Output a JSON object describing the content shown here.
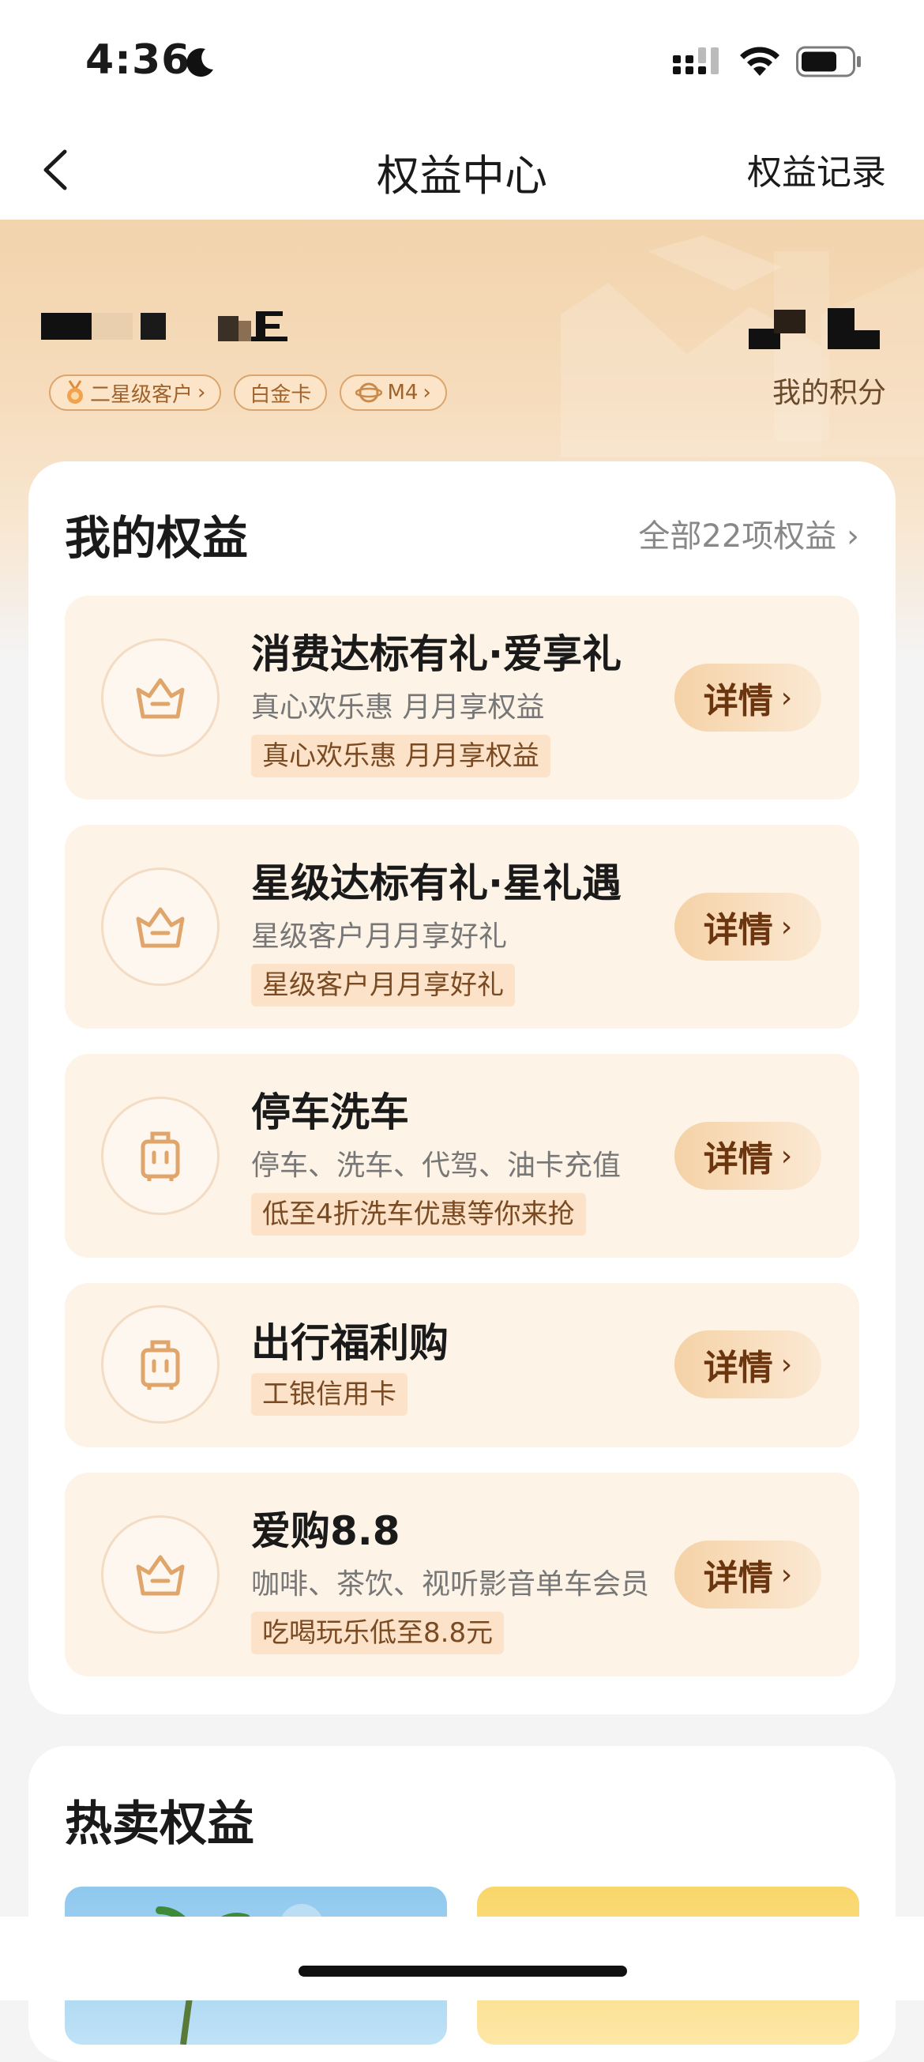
{
  "status_bar": {
    "time": "4:36"
  },
  "nav": {
    "title": "权益中心",
    "right_label": "权益记录"
  },
  "user": {
    "points_label": "我的积分",
    "badges": [
      {
        "label": "二星级客户",
        "icon": "medal-icon"
      },
      {
        "label": "白金卡"
      },
      {
        "label": "M4",
        "icon": "planet-icon"
      }
    ]
  },
  "my_rights": {
    "title": "我的权益",
    "more_label": "全部22项权益",
    "detail_label": "详情",
    "items": [
      {
        "title": "消费达标有礼·爱享礼",
        "subtitle": "真心欢乐惠 月月享权益",
        "tag": "真心欢乐惠 月月享权益",
        "icon": "basket-icon"
      },
      {
        "title": "星级达标有礼·星礼遇",
        "subtitle": "星级客户月月享好礼",
        "tag": "星级客户月月享好礼",
        "icon": "basket-icon"
      },
      {
        "title": "停车洗车",
        "subtitle": "停车、洗车、代驾、油卡充值",
        "tag": "低至4折洗车优惠等你来抢",
        "icon": "luggage-icon"
      },
      {
        "title": "出行福利购",
        "subtitle": "",
        "tag": "工银信用卡",
        "icon": "luggage-icon"
      },
      {
        "title": "爱购8.8",
        "subtitle": "咖啡、茶饮、视听影音单车会员",
        "tag": "吃喝玩乐低至8.8元",
        "icon": "basket-icon"
      }
    ]
  },
  "hot_rights": {
    "title": "热卖权益"
  },
  "colors": {
    "accent": "#6b3510",
    "card_bg": "#fdf3e6",
    "tag_bg": "#fbe2c8"
  }
}
